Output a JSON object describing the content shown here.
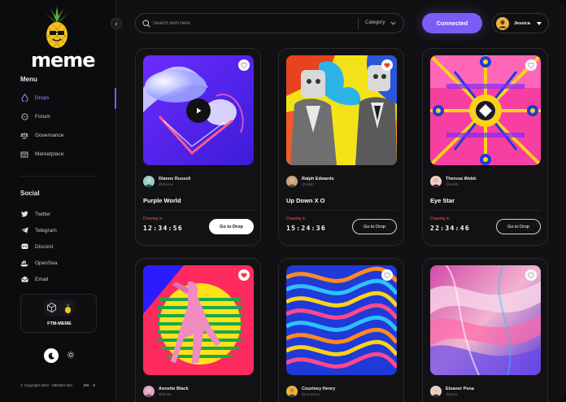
{
  "brand": {
    "name": "meme"
  },
  "menu": {
    "title": "Menu",
    "items": [
      {
        "label": "Drops",
        "icon": "drop-icon",
        "active": true
      },
      {
        "label": "Forum",
        "icon": "chat-icon"
      },
      {
        "label": "Governance",
        "icon": "scales-icon"
      },
      {
        "label": "Marketplace",
        "icon": "store-icon"
      }
    ]
  },
  "social": {
    "title": "Social",
    "items": [
      {
        "label": "Twitter",
        "icon": "twitter-icon"
      },
      {
        "label": "Telegram",
        "icon": "telegram-icon"
      },
      {
        "label": "Discord",
        "icon": "discord-icon"
      },
      {
        "label": "OpenSea",
        "icon": "opensea-icon"
      },
      {
        "label": "Email",
        "icon": "email-icon"
      }
    ]
  },
  "token": {
    "label": "FTM-MEME"
  },
  "footer": {
    "copyright": "© Copyright 2022 - MEMEX INC",
    "language": "EN"
  },
  "search": {
    "placeholder": "Search item here",
    "category_label": "Category"
  },
  "header": {
    "connect_label": "Connected",
    "user_name": "Jessica"
  },
  "labels": {
    "drawing_in": "Drawing in",
    "go_to_drop": "Go to Drop"
  },
  "cards": [
    {
      "creator": "Dianne Russell",
      "handle": "@dianne",
      "title": "Purple World",
      "timer": "12:34:56",
      "favorited": false,
      "has_video": true,
      "primary_button": true
    },
    {
      "creator": "Ralph Edwards",
      "handle": "@ralph",
      "title": "Up Down X O",
      "timer": "15:24:36",
      "favorited": true
    },
    {
      "creator": "Theresa Webb",
      "handle": "@webb",
      "title": "Eye Star",
      "timer": "22:34:46",
      "favorited": false
    },
    {
      "creator": "Annette Black",
      "handle": "@annie",
      "favorited": true
    },
    {
      "creator": "Courtney Henry",
      "handle": "@courtney",
      "favorited": false
    },
    {
      "creator": "Eleanor Pena",
      "handle": "@pena",
      "favorited": false
    }
  ],
  "colors": {
    "accent": "#7c5cf6",
    "timer_label": "#ef5a3a",
    "favorite": "#e8442f",
    "background": "#111113"
  }
}
